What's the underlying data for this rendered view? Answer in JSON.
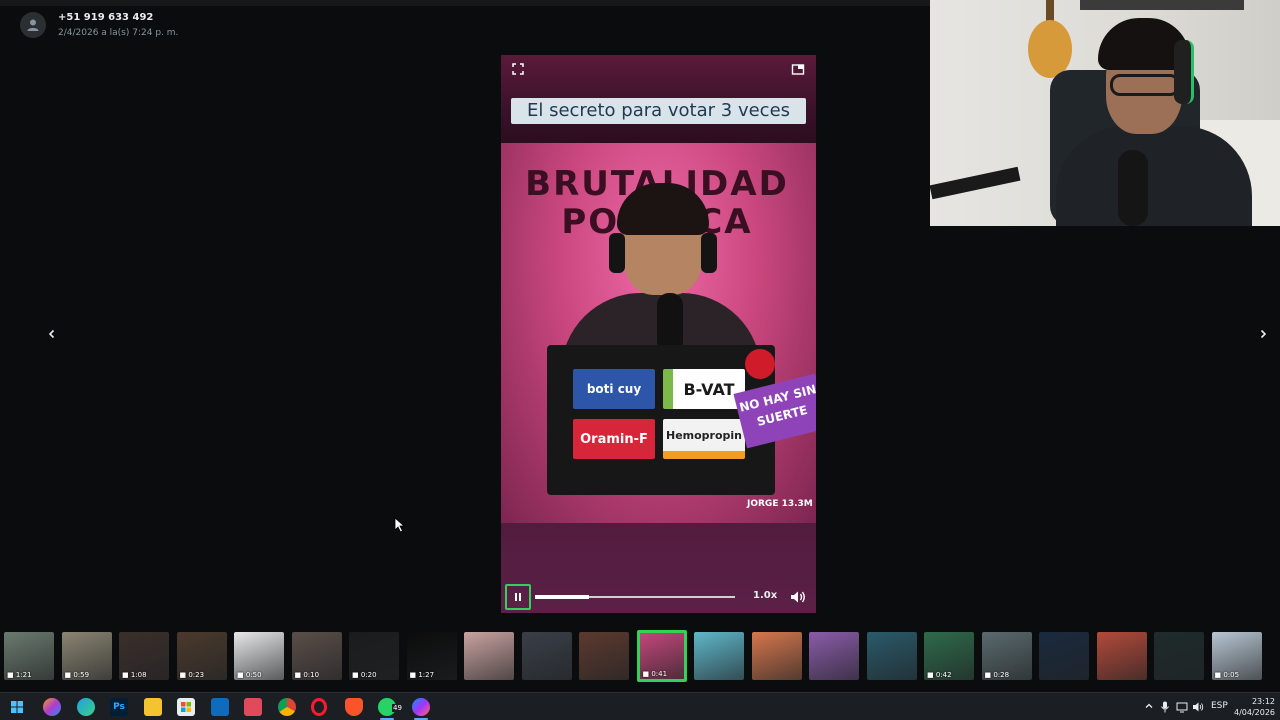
{
  "sender": {
    "name": "+51 919 633 492",
    "datetime": "2/4/2026 a la(s) 7:24 p. m."
  },
  "video": {
    "caption": "El secreto para votar 3 veces",
    "sign_text": "BRUTALIDAD POLITICA",
    "sticker_1": "boti cuy",
    "sticker_2": "B-VAT",
    "sticker_3": "Oramin-F",
    "sticker_4": "Hemopropin",
    "badge": "NO HAY SIN SUERTE",
    "watermark": "JORGE 13.3M",
    "progress": 0.27,
    "speed": "1.0x"
  },
  "thumbnails": [
    {
      "duration": "1:21",
      "color": "#6a7a6e"
    },
    {
      "duration": "0:59",
      "color": "#8a8472"
    },
    {
      "duration": "1:08",
      "color": "#3b2f2a"
    },
    {
      "duration": "0:23",
      "color": "#4a3a2c"
    },
    {
      "duration": "0:50",
      "color": "#e8e8ea"
    },
    {
      "duration": "0:10",
      "color": "#5a4e48"
    },
    {
      "duration": "0:20",
      "color": "#1a1c1e"
    },
    {
      "duration": "1:27",
      "color": "#0c0c0c"
    },
    {
      "duration": "",
      "color": "#c9a3a0"
    },
    {
      "duration": "",
      "color": "#3a3f48"
    },
    {
      "duration": "",
      "color": "#5c3a2e"
    },
    {
      "duration": "0:41",
      "color": "#c4477a"
    },
    {
      "duration": "",
      "color": "#5fb7c9"
    },
    {
      "duration": "",
      "color": "#d6774d"
    },
    {
      "duration": "",
      "color": "#8a5ca8"
    },
    {
      "duration": "",
      "color": "#2a5a6a"
    },
    {
      "duration": "0:42",
      "color": "#2e6a4a"
    },
    {
      "duration": "0:28",
      "color": "#5a6a6e"
    },
    {
      "duration": "",
      "color": "#1a2a3e"
    },
    {
      "duration": "",
      "color": "#b34a3a"
    },
    {
      "duration": "",
      "color": "#1e2c2a"
    },
    {
      "duration": "0:05",
      "color": "#b8c6d2"
    }
  ],
  "taskbar": {
    "apps": [
      "start-icon",
      "copilot-icon",
      "edge-icon",
      "photoshop-icon",
      "file-explorer-icon",
      "store-icon",
      "outlook-icon",
      "app-icon",
      "chrome-icon",
      "opera-icon",
      "brave-icon",
      "whatsapp-icon",
      "messenger-icon"
    ],
    "ps_label": "Ps",
    "whatsapp_count": "49",
    "language": "ESP",
    "time": "23:12",
    "date": "4/04/2026"
  },
  "colors": {
    "accent_green": "#35d05a",
    "background": "#0b0c0d"
  }
}
